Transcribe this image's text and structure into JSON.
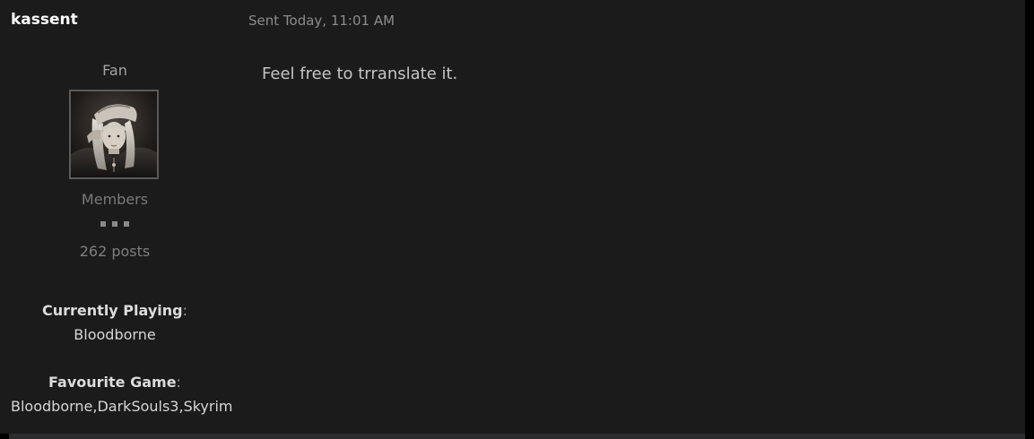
{
  "author": {
    "name": "kassent",
    "title": "Fan",
    "group": "Members",
    "post_count": "262 posts",
    "rank_pips": 3
  },
  "post": {
    "date": "Sent Today, 11:01 AM",
    "body": "Feel free to trranslate it."
  },
  "profile_fields": {
    "currently_playing": {
      "label": "Currently Playing",
      "colon": ":",
      "value": "Bloodborne"
    },
    "favourite_game": {
      "label": "Favourite Game",
      "colon": ":",
      "value": "Bloodborne,DarkSouls3,Skyrim"
    }
  },
  "colors": {
    "background": "#1b1b1c",
    "author_name": "#ffffff",
    "muted_text": "#8c8c8c",
    "body_text": "#c4c4c4"
  }
}
